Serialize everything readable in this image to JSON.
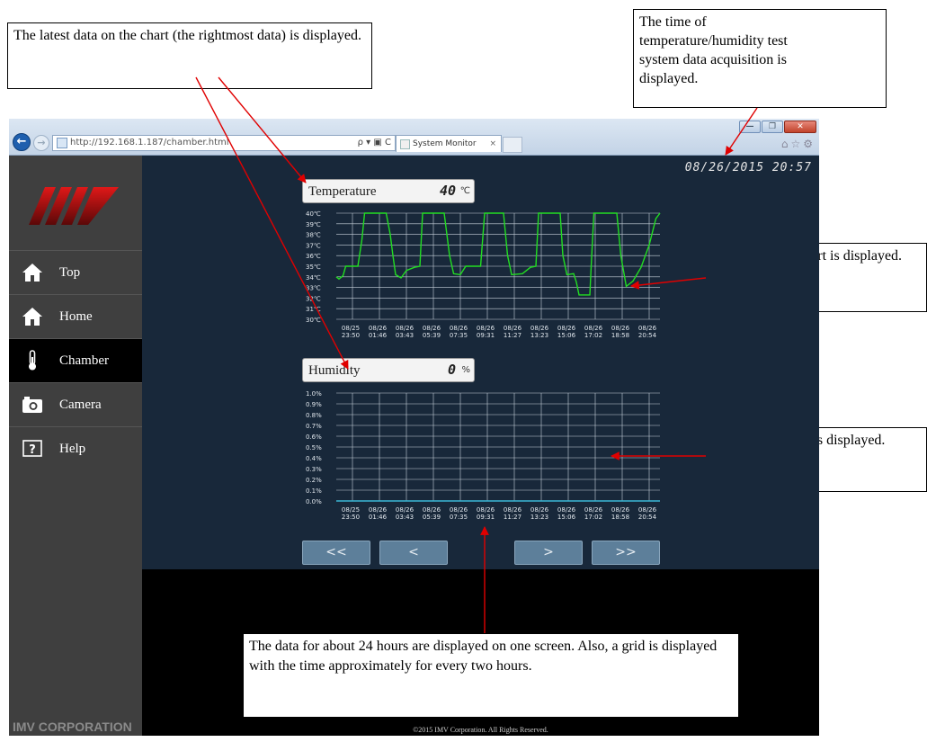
{
  "browser": {
    "url": "http://192.168.1.187/chamber.html",
    "tab_title": "System Monitor",
    "tab_close": "×",
    "back_glyph": "←",
    "forward_glyph": "→",
    "address_tools": "ρ ▾ ▣ C",
    "window_buttons": {
      "minimize": "—",
      "maximize": "❐",
      "close": "✕"
    },
    "chrome_icons": "⌂☆⚙"
  },
  "datetime": "08/26/2015 20:57",
  "sidebar": {
    "items": [
      {
        "label": "Top",
        "icon": "home-icon"
      },
      {
        "label": "Home",
        "icon": "home-icon"
      },
      {
        "label": "Chamber",
        "icon": "thermometer-icon",
        "active": true
      },
      {
        "label": "Camera",
        "icon": "camera-icon"
      },
      {
        "label": "Help",
        "icon": "help-icon"
      }
    ],
    "footer": "IMV CORPORATION"
  },
  "temperature": {
    "label": "Temperature",
    "value": "40",
    "unit": "℃"
  },
  "humidity": {
    "label": "Humidity",
    "value": "0",
    "unit": "%"
  },
  "pager": {
    "first": "<<",
    "prev": "<",
    "next": ">",
    "last": ">>"
  },
  "copyright": "©2015 IMV Corporation. All Rights Reserved.",
  "colors": {
    "accent_line": "#22dd22",
    "humidity_line": "#3ab8d6",
    "panel": "#18283a",
    "sidebar": "#3f3f3f"
  },
  "chart_data": [
    {
      "type": "line",
      "name": "temperature",
      "y_ticks": [
        "40℃",
        "39℃",
        "38℃",
        "37℃",
        "36℃",
        "35℃",
        "34℃",
        "33℃",
        "32℃",
        "31℃",
        "30℃"
      ],
      "ylim": [
        30,
        40
      ],
      "x_ticks": [
        {
          "date": "08/25",
          "time": "23:50"
        },
        {
          "date": "08/26",
          "time": "01:46"
        },
        {
          "date": "08/26",
          "time": "03:43"
        },
        {
          "date": "08/26",
          "time": "05:39"
        },
        {
          "date": "08/26",
          "time": "07:35"
        },
        {
          "date": "08/26",
          "time": "09:31"
        },
        {
          "date": "08/26",
          "time": "11:27"
        },
        {
          "date": "08/26",
          "time": "13:23"
        },
        {
          "date": "08/26",
          "time": "15:06"
        },
        {
          "date": "08/26",
          "time": "17:02"
        },
        {
          "date": "08/26",
          "time": "18:58"
        },
        {
          "date": "08/26",
          "time": "20:54"
        }
      ],
      "xlim": [
        0,
        11
      ],
      "grid": true,
      "points": [
        [
          0,
          34.0
        ],
        [
          0.1,
          33.8
        ],
        [
          0.25,
          34.1
        ],
        [
          0.35,
          35.0
        ],
        [
          0.8,
          35.0
        ],
        [
          0.95,
          37.5
        ],
        [
          1.05,
          40
        ],
        [
          1.85,
          40
        ],
        [
          2.0,
          38
        ],
        [
          2.1,
          36
        ],
        [
          2.2,
          34.2
        ],
        [
          2.4,
          33.9
        ],
        [
          2.6,
          34.6
        ],
        [
          2.9,
          34.9
        ],
        [
          3.1,
          35.0
        ],
        [
          3.2,
          40
        ],
        [
          4.0,
          40
        ],
        [
          4.2,
          36
        ],
        [
          4.35,
          34.3
        ],
        [
          4.6,
          34.2
        ],
        [
          4.8,
          35.0
        ],
        [
          5.35,
          35.0
        ],
        [
          5.5,
          40
        ],
        [
          6.2,
          40
        ],
        [
          6.35,
          36
        ],
        [
          6.5,
          34.2
        ],
        [
          6.9,
          34.3
        ],
        [
          7.2,
          34.9
        ],
        [
          7.4,
          35.0
        ],
        [
          7.5,
          40
        ],
        [
          8.3,
          40
        ],
        [
          8.4,
          36
        ],
        [
          8.55,
          34.2
        ],
        [
          8.8,
          34.3
        ],
        [
          8.9,
          33.5
        ],
        [
          9.0,
          32.3
        ],
        [
          9.4,
          32.3
        ],
        [
          9.45,
          35
        ],
        [
          9.55,
          40
        ],
        [
          10.4,
          40
        ],
        [
          10.55,
          36
        ],
        [
          10.75,
          33.1
        ],
        [
          11.0,
          33.6
        ],
        [
          11.3,
          34.9
        ],
        [
          11.6,
          37
        ],
        [
          11.85,
          39.5
        ],
        [
          12.0,
          40
        ]
      ]
    },
    {
      "type": "line",
      "name": "humidity",
      "y_ticks": [
        "1.0%",
        "0.9%",
        "0.8%",
        "0.7%",
        "0.6%",
        "0.5%",
        "0.4%",
        "0.3%",
        "0.2%",
        "0.1%",
        "0.0%"
      ],
      "ylim": [
        0,
        1.0
      ],
      "x_ticks": [
        {
          "date": "08/25",
          "time": "23:50"
        },
        {
          "date": "08/26",
          "time": "01:46"
        },
        {
          "date": "08/26",
          "time": "03:43"
        },
        {
          "date": "08/26",
          "time": "05:39"
        },
        {
          "date": "08/26",
          "time": "07:35"
        },
        {
          "date": "08/26",
          "time": "09:31"
        },
        {
          "date": "08/26",
          "time": "11:27"
        },
        {
          "date": "08/26",
          "time": "13:23"
        },
        {
          "date": "08/26",
          "time": "15:06"
        },
        {
          "date": "08/26",
          "time": "17:02"
        },
        {
          "date": "08/26",
          "time": "18:58"
        },
        {
          "date": "08/26",
          "time": "20:54"
        }
      ],
      "xlim": [
        0,
        11
      ],
      "grid": true,
      "points": [
        [
          0,
          0.0
        ],
        [
          12,
          0.0
        ]
      ]
    }
  ],
  "annotations": {
    "latest_data": "The latest data on the chart (the rightmost data) is displayed.",
    "acquisition_time": "The time of temperature/humidity test system data acquisition is displayed.",
    "temperature_chart": "A temperature chart is displayed.",
    "humidity_chart": "A humidity chart is displayed.",
    "time_span": "The data for about 24 hours are displayed on one screen. Also, a grid is displayed with the time approximately for every two hours."
  }
}
